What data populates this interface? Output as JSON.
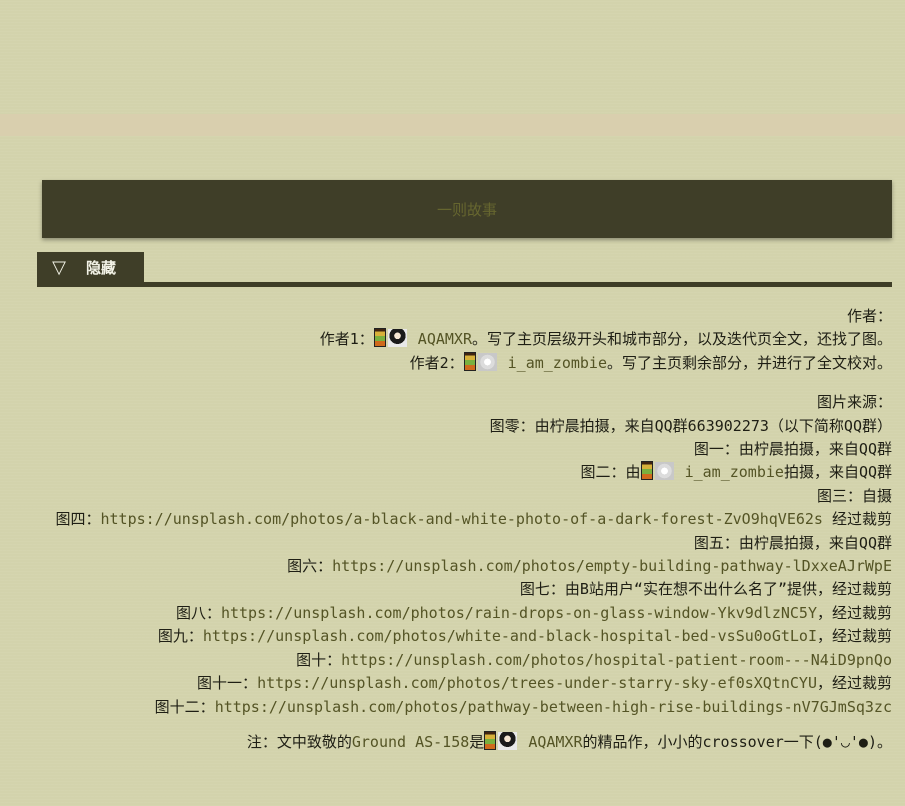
{
  "header": {
    "title": "一则故事"
  },
  "collapse": {
    "icon": "▽",
    "label": "隐藏"
  },
  "authors": {
    "heading": "作者：",
    "a1": {
      "prefix": "作者1：",
      "name": "AQAMXR",
      "desc": "。写了主页层级开头和城市部分，以及迭代页全文，还找了图。"
    },
    "a2": {
      "prefix": "作者2：",
      "name": "i_am_zombie",
      "desc": "。写了主页剩余部分，并进行了全文校对。"
    }
  },
  "images": {
    "heading": "图片来源：",
    "i0": "图零：由柠晨拍摄，来自QQ群663902273（以下简称QQ群）",
    "i1": "图一：由柠晨拍摄，来自QQ群",
    "i2": {
      "prefix": "图二：由",
      "name": "i_am_zombie",
      "suffix": "拍摄，来自QQ群"
    },
    "i3": "图三：自摄",
    "i4": {
      "prefix": "图四：",
      "url": "https://unsplash.com/photos/a-black-and-white-photo-of-a-dark-forest-ZvO9hqVE62s",
      "suffix": " 经过裁剪"
    },
    "i5": "图五：由柠晨拍摄，来自QQ群",
    "i6": {
      "prefix": "图六：",
      "url": "https://unsplash.com/photos/empty-building-pathway-lDxxeAJrWpE"
    },
    "i7": "图七：由B站用户“实在想不出什么名了”提供，经过裁剪",
    "i8": {
      "prefix": "图八：",
      "url": "https://unsplash.com/photos/rain-drops-on-glass-window-Ykv9dlzNC5Y",
      "suffix": "，经过裁剪"
    },
    "i9": {
      "prefix": "图九：",
      "url": "https://unsplash.com/photos/white-and-black-hospital-bed-vsSu0oGtLoI",
      "suffix": "，经过裁剪"
    },
    "i10": {
      "prefix": "图十：",
      "url": "https://unsplash.com/photos/hospital-patient-room---N4iD9pnQo"
    },
    "i11": {
      "prefix": "图十一：",
      "url": "https://unsplash.com/photos/trees-under-starry-sky-ef0sXQtnCYU",
      "suffix": "，经过裁剪"
    },
    "i12": {
      "prefix": "图十二：",
      "url": "https://unsplash.com/photos/pathway-between-high-rise-buildings-nV7GJmSq3zc"
    }
  },
  "note": {
    "prefix": "注：文中致敬的",
    "link": "Ground AS-158",
    "mid": "是",
    "name": "AQAMXR",
    "suffix": "的精品作，小小的crossover一下(●'◡'●)。"
  },
  "colors": {
    "background": "#d3d3ac",
    "bar": "#3f3e28",
    "link": "#545425"
  }
}
